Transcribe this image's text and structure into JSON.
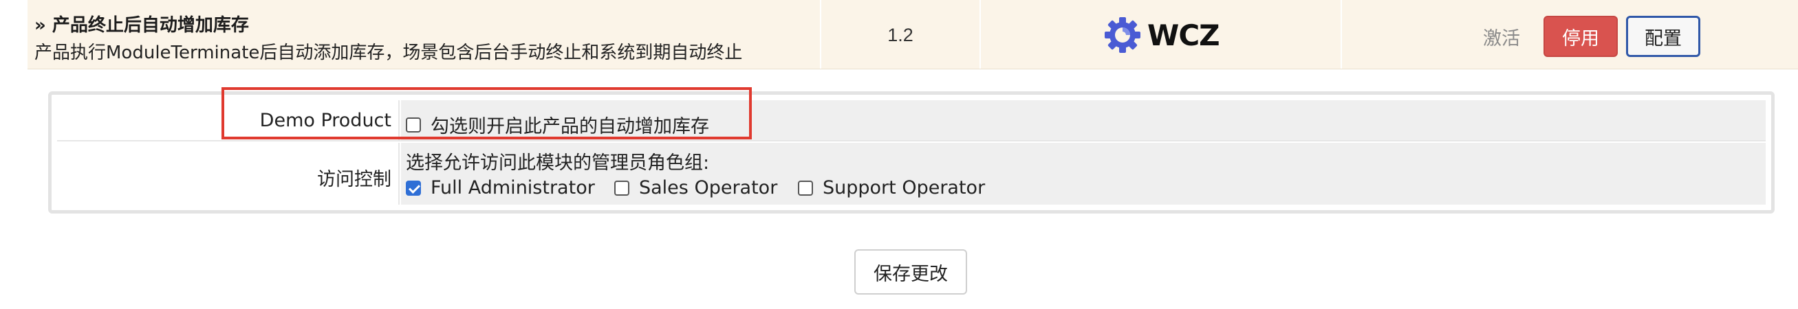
{
  "module": {
    "title": "» 产品终止后自动增加库存",
    "description": "产品执行ModuleTerminate后自动添加库存，场景包含后台手动终止和系统到期自动终止",
    "version": "1.2",
    "vendor_logo_text": "WCZ",
    "vendor_logo_color": "#4a5bd4",
    "vendor_logo_icon": "gear-icon",
    "status_label": "激活",
    "disable_label": "停用",
    "config_label": "配置"
  },
  "settings": {
    "demo_product": {
      "label": "Demo Product",
      "checkbox_text": "勾选则开启此产品的自动增加库存",
      "checked": false
    },
    "access_control": {
      "label": "访问控制",
      "caption": "选择允许访问此模块的管理员角色组:",
      "roles": [
        {
          "name": "Full Administrator",
          "checked": true
        },
        {
          "name": "Sales Operator",
          "checked": false
        },
        {
          "name": "Support Operator",
          "checked": false
        }
      ]
    }
  },
  "save_label": "保存更改",
  "colors": {
    "row_background": "#fbf4e8",
    "disable_button": "#d9534f",
    "config_border": "#2f57a8",
    "highlight": "#e03a2f",
    "checkbox_checked": "#2f6fd6"
  }
}
